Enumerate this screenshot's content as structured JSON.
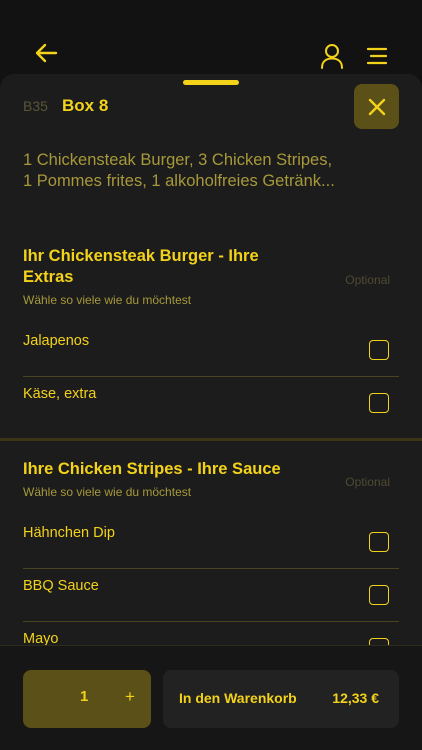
{
  "colors": {
    "accent": "#f3d21a",
    "muted_text": "#a7983a",
    "background": "#111111",
    "sheet": "#1c1c1c",
    "button_fill": "#5b5118"
  },
  "header": {
    "back_icon": "arrow-left-icon",
    "user_icon": "user-icon",
    "menu_icon": "menu-icon"
  },
  "item": {
    "code": "B35",
    "name": "Box 8",
    "description_line1": "1 Chickensteak Burger, 3 Chicken Stripes,",
    "description_line2": "1 Pommes frites, 1 alkoholfreies Getränk...",
    "close_icon": "close-icon"
  },
  "sections": [
    {
      "title_line1": "Ihr Chickensteak Burger - Ihre",
      "title_line2": "Extras",
      "subtitle": "Wähle so viele wie du möchtest",
      "optional": "Optional",
      "options": [
        {
          "label": "Jalapenos",
          "checked": false
        },
        {
          "label": "Käse, extra",
          "checked": false
        }
      ]
    },
    {
      "title_line1": "Ihre Chicken Stripes - Ihre Sauce",
      "subtitle": "Wähle so viele wie du möchtest",
      "optional": "Optional",
      "options": [
        {
          "label": "Hähnchen Dip",
          "checked": false
        },
        {
          "label": "BBQ Sauce",
          "checked": false
        },
        {
          "label": "Mayo",
          "checked": false
        }
      ]
    }
  ],
  "footer": {
    "quantity": "1",
    "plus_label": "+",
    "cart_label": "In den Warenkorb",
    "price": "12,33 €"
  }
}
